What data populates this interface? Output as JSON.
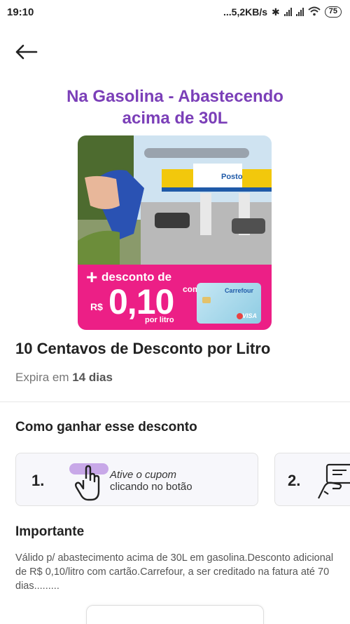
{
  "status_bar": {
    "time": "19:10",
    "network_speed": "...5,2KB/s",
    "battery": "75"
  },
  "header": {
    "back_icon": "arrow-left-icon"
  },
  "offer": {
    "hero_title": "Na Gasolina - Abastecendo acima de 30L",
    "banner": {
      "discount_prefix": "+",
      "discount_label": "desconto de",
      "currency": "R$",
      "value": "0,10",
      "unit": "por litro",
      "card_text": "com o",
      "card_brand": "Carrefour",
      "card_network": "VISA",
      "station_sign": "Posto",
      "colors": {
        "pink": "#ec1f86",
        "purple": "#7b3fb8"
      }
    },
    "title": "10 Centavos de Desconto por Litro",
    "expires_prefix": "Expira em",
    "expires_value": "14 dias"
  },
  "how_to": {
    "title": "Como ganhar esse desconto",
    "steps": [
      {
        "number": "1.",
        "line1": "Ative o cupom",
        "line2": "clicando no botão",
        "icon": "tap-hand-icon"
      },
      {
        "number": "2.",
        "icon": "card-hand-icon"
      }
    ]
  },
  "important": {
    "title": "Importante",
    "text": "Válido p/ abastecimento acima de 30L em gasolina.Desconto adicional de R$ 0,10/litro com cartão.Carrefour, a ser creditado na fatura até 70 dias........."
  }
}
